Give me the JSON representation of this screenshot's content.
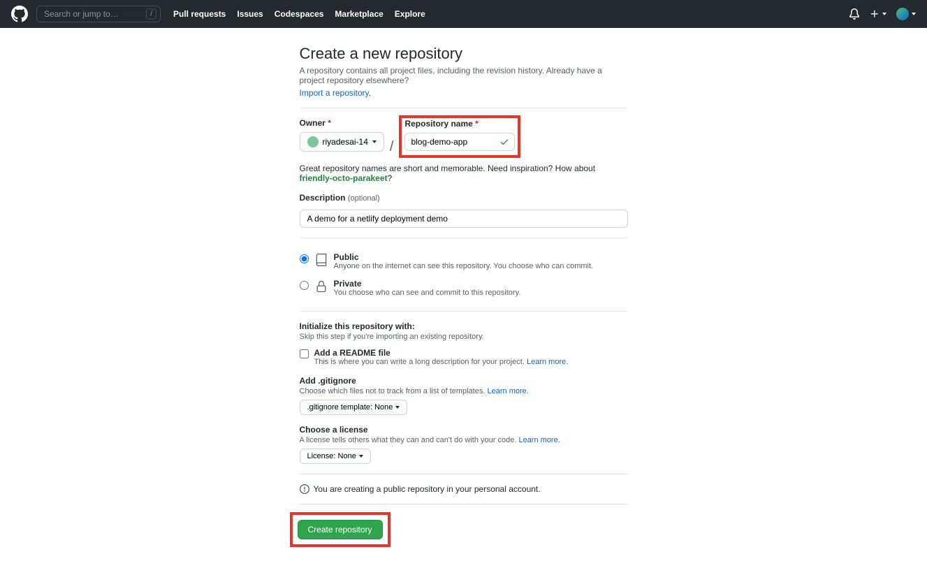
{
  "header": {
    "search_placeholder": "Search or jump to…",
    "nav": [
      "Pull requests",
      "Issues",
      "Codespaces",
      "Marketplace",
      "Explore"
    ]
  },
  "page": {
    "title": "Create a new repository",
    "subtitle": "A repository contains all project files, including the revision history. Already have a project repository elsewhere?",
    "import_link": "Import a repository"
  },
  "owner": {
    "label": "Owner",
    "value": "riyadesai-14"
  },
  "repo_name": {
    "label": "Repository name",
    "value": "blog-demo-app"
  },
  "hint": {
    "text": "Great repository names are short and memorable. Need inspiration? How about ",
    "suggestion": "friendly-octo-parakeet",
    "suffix": "?"
  },
  "description": {
    "label": "Description",
    "optional": "(optional)",
    "value": "A demo for a netlify deployment demo"
  },
  "visibility": {
    "public": {
      "title": "Public",
      "desc": "Anyone on the internet can see this repository. You choose who can commit."
    },
    "private": {
      "title": "Private",
      "desc": "You choose who can see and commit to this repository."
    }
  },
  "init": {
    "title": "Initialize this repository with:",
    "desc": "Skip this step if you're importing an existing repository."
  },
  "readme": {
    "title": "Add a README file",
    "desc": "This is where you can write a long description for your project. ",
    "learn": "Learn more."
  },
  "gitignore": {
    "title": "Add .gitignore",
    "desc": "Choose which files not to track from a list of templates. ",
    "learn": "Learn more.",
    "button": ".gitignore template: None"
  },
  "license": {
    "title": "Choose a license",
    "desc": "A license tells others what they can and can't do with your code. ",
    "learn": "Learn more.",
    "button": "License: None"
  },
  "info_text": "You are creating a public repository in your personal account.",
  "create_button": "Create repository"
}
